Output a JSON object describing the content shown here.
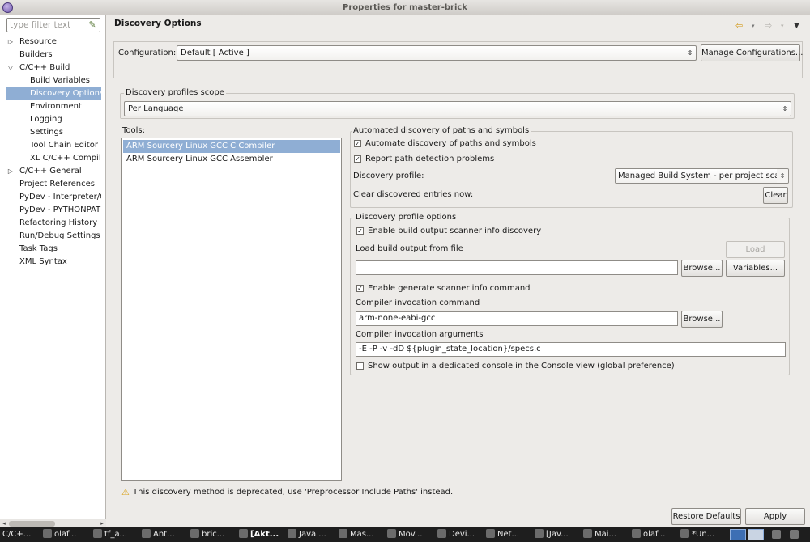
{
  "window": {
    "title": "Properties for master-brick"
  },
  "filter": {
    "placeholder": "type filter text"
  },
  "tree": [
    {
      "label": "Resource",
      "indent": 0,
      "expander": "closed",
      "selected": false
    },
    {
      "label": "Builders",
      "indent": 0,
      "expander": "none",
      "selected": false
    },
    {
      "label": "C/C++ Build",
      "indent": 0,
      "expander": "open",
      "selected": false
    },
    {
      "label": "Build Variables",
      "indent": 1,
      "expander": "none",
      "selected": false
    },
    {
      "label": "Discovery Options",
      "indent": 1,
      "expander": "none",
      "selected": true
    },
    {
      "label": "Environment",
      "indent": 1,
      "expander": "none",
      "selected": false
    },
    {
      "label": "Logging",
      "indent": 1,
      "expander": "none",
      "selected": false
    },
    {
      "label": "Settings",
      "indent": 1,
      "expander": "none",
      "selected": false
    },
    {
      "label": "Tool Chain Editor",
      "indent": 1,
      "expander": "none",
      "selected": false
    },
    {
      "label": "XL C/C++ Compiler",
      "indent": 1,
      "expander": "none",
      "selected": false
    },
    {
      "label": "C/C++ General",
      "indent": 0,
      "expander": "closed",
      "selected": false
    },
    {
      "label": "Project References",
      "indent": 0,
      "expander": "none",
      "selected": false
    },
    {
      "label": "PyDev - Interpreter/G",
      "indent": 0,
      "expander": "none",
      "selected": false
    },
    {
      "label": "PyDev - PYTHONPATH",
      "indent": 0,
      "expander": "none",
      "selected": false
    },
    {
      "label": "Refactoring History",
      "indent": 0,
      "expander": "none",
      "selected": false
    },
    {
      "label": "Run/Debug Settings",
      "indent": 0,
      "expander": "none",
      "selected": false
    },
    {
      "label": "Task Tags",
      "indent": 0,
      "expander": "none",
      "selected": false
    },
    {
      "label": "XML Syntax",
      "indent": 0,
      "expander": "none",
      "selected": false
    }
  ],
  "page": {
    "title": "Discovery Options"
  },
  "configuration": {
    "label": "Configuration:",
    "value": "Default  [ Active ]",
    "manage_button": "Manage Configurations..."
  },
  "scope": {
    "title": "Discovery profiles scope",
    "value": "Per Language"
  },
  "tools": {
    "label": "Tools:",
    "items": [
      {
        "label": "ARM Sourcery Linux GCC C Compiler",
        "selected": true
      },
      {
        "label": "ARM Sourcery Linux GCC Assembler",
        "selected": false
      }
    ]
  },
  "automated": {
    "title": "Automated discovery of paths and symbols",
    "automate_label": "Automate discovery of paths and symbols",
    "automate_checked": true,
    "report_label": "Report path detection problems",
    "report_checked": true,
    "profile_label": "Discovery profile:",
    "profile_value": "Managed Build System - per project scann",
    "clear_label": "Clear discovered entries now:",
    "clear_button": "Clear"
  },
  "profile_options": {
    "title": "Discovery profile options",
    "enable_scanner_label": "Enable build output scanner info discovery",
    "enable_scanner_checked": true,
    "load_label": "Load build output from file",
    "load_button": "Load",
    "load_file_value": "",
    "browse_button": "Browse...",
    "variables_button": "Variables...",
    "enable_generate_label": "Enable generate scanner info command",
    "enable_generate_checked": true,
    "cmd_label": "Compiler invocation command",
    "cmd_value": "arm-none-eabi-gcc",
    "args_label": "Compiler invocation arguments",
    "args_value": "-E -P -v -dD ${plugin_state_location}/specs.c",
    "console_label": "Show output in a dedicated console in the Console view (global preference)",
    "console_checked": false
  },
  "warning": {
    "text": "This discovery method is deprecated, use 'Preprocessor Include Paths' instead."
  },
  "footer": {
    "restore_button": "Restore Defaults",
    "apply_button": "Apply"
  },
  "taskbar": [
    "C/C+...",
    "olaf...",
    "tf_a...",
    "Ant...",
    "bric...",
    "[Akt...",
    "Java ...",
    "Mas...",
    "Mov...",
    "Devi...",
    "Net...",
    "[Jav...",
    "Mai...",
    "olaf...",
    "*Un..."
  ]
}
